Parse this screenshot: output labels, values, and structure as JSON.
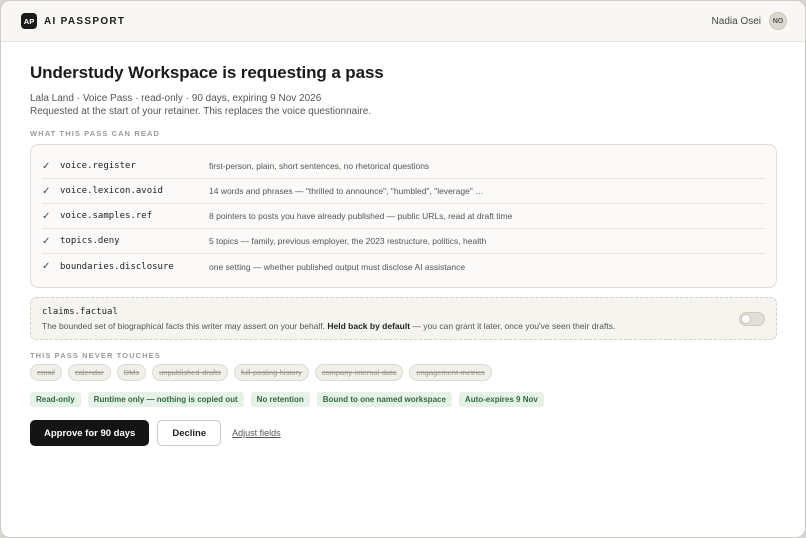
{
  "app": {
    "logo_text": "AP",
    "name": "AI PASSPORT"
  },
  "user": {
    "name": "Nadia Osei",
    "initials": "NO"
  },
  "request": {
    "title": "Understudy Workspace is requesting a pass",
    "meta": "Lala Land · Voice Pass · read-only · 90 days, expiring 9 Nov 2026",
    "note": "Requested at the start of your retainer. This replaces the voice questionnaire."
  },
  "read_section": {
    "label": "WHAT THIS PASS CAN READ",
    "check_glyph": "✓",
    "items": [
      {
        "key": "voice.register",
        "desc": "first-person, plain, short sentences, no rhetorical questions"
      },
      {
        "key": "voice.lexicon.avoid",
        "desc": "14 words and phrases — \"thrilled to announce\", \"humbled\", \"leverage\" …"
      },
      {
        "key": "voice.samples.ref",
        "desc": "8 pointers to posts you have already published — public URLs, read at draft time"
      },
      {
        "key": "topics.deny",
        "desc": "5 topics — family, previous employer, the 2023 restructure, politics, health"
      },
      {
        "key": "boundaries.disclosure",
        "desc": "one setting — whether published output must disclose AI assistance"
      }
    ]
  },
  "claims": {
    "key": "claims.factual",
    "desc_before": "The bounded set of biographical facts this writer may assert on your behalf. ",
    "desc_bold": "Held back by default",
    "desc_after": " — you can grant it later, once you've seen their drafts.",
    "enabled": false
  },
  "never_section": {
    "label": "THIS PASS NEVER TOUCHES",
    "items": [
      "email",
      "calendar",
      "DMs",
      "unpublished-drafts",
      "full-posting-history",
      "company-internal-data",
      "engagement-metrics"
    ]
  },
  "tags": [
    "Read-only",
    "Runtime only — nothing is copied out",
    "No retention",
    "Bound to one named workspace",
    "Auto-expires 9 Nov"
  ],
  "actions": {
    "approve": "Approve for 90 days",
    "decline": "Decline",
    "adjust": "Adjust fields"
  },
  "colors": {
    "primary": "#141414",
    "tag_green": "#2f6b44",
    "tag_bg": "#e6f1e8"
  }
}
